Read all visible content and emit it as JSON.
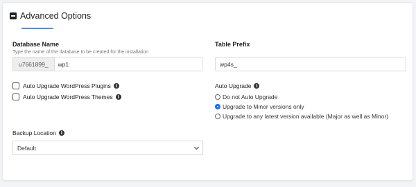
{
  "section": {
    "title": "Advanced Options"
  },
  "database": {
    "label": "Database Name",
    "help": "Type the name of the database to be created for the installation",
    "prefix": "u7661899_",
    "value": "wp1"
  },
  "table_prefix": {
    "label": "Table Prefix",
    "value": "wp4s_"
  },
  "plugins_checkbox": {
    "label": "Auto Upgrade WordPress Plugins",
    "checked": false
  },
  "themes_checkbox": {
    "label": "Auto Upgrade WordPress Themes",
    "checked": false
  },
  "auto_upgrade": {
    "label": "Auto Upgrade",
    "options": [
      {
        "label": "Do not Auto Upgrade",
        "selected": false
      },
      {
        "label": "Upgrade to Minor versions only",
        "selected": true
      },
      {
        "label": "Upgrade to any latest version available (Major as well as Minor)",
        "selected": false
      }
    ]
  },
  "backup": {
    "label": "Backup Location",
    "value": "Default"
  },
  "icons": {
    "info": "info-icon",
    "collapse": "minus-square-icon",
    "dropdown": "chevron-down-icon"
  },
  "colors": {
    "accent": "#4d8de8",
    "radio_selected": "#1a6ef5"
  }
}
